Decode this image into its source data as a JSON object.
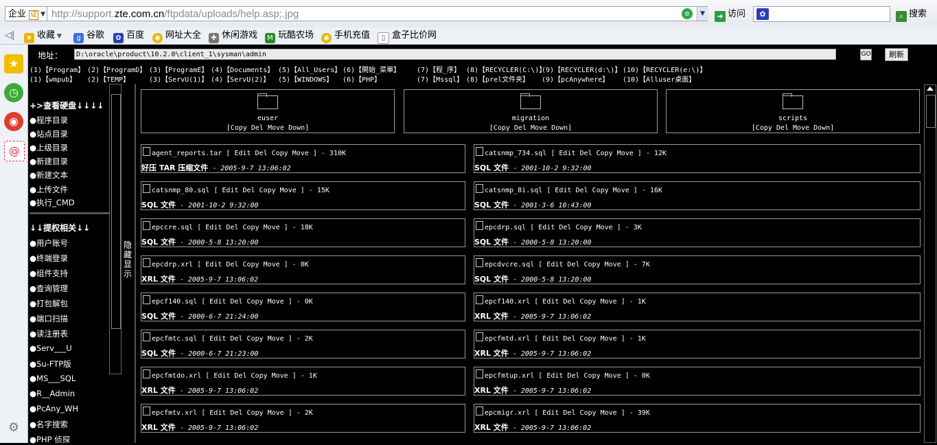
{
  "browser": {
    "combo_label": "企业",
    "combo_badge": "证",
    "url_prefix": "http://support.",
    "url_host": "zte.com.cn",
    "url_rest": "/ftpdata/uploads/help.asp;.jpg",
    "visit_label": "访问",
    "search_label": "搜索"
  },
  "favorites": [
    "收藏",
    "谷歌",
    "百度",
    "网址大全",
    "休闲游戏",
    "玩酷农场",
    "手机充值",
    "盒子比价网"
  ],
  "page": {
    "addr_label": "地址：",
    "path": "D:\\oracle\\product\\10.2.0\\client_1\\sysman\\admin",
    "go_label": "GO",
    "refresh_label": "刷新",
    "quick_row1": [
      "(1)【Program】",
      "(2)【ProgramD】",
      "(3)【ProgramE】",
      "(4)【Documents】",
      "(5)【All_Users】",
      "(6)【開始_菜單】",
      "(7)【程_序】",
      "(8)【RECYCLER(C:\\)】",
      "(9)【RECYCLER(d:\\)】",
      "(10)【RECYCLER(e:\\)】"
    ],
    "quick_row2": [
      "(1)【wmpub】",
      "(2)【TEMP】",
      "(3)【ServU(1)】",
      "(4)【ServU(2)】",
      "(5)【WINDOWS】",
      "(6)【PHP】",
      "(7)【Mssql】",
      "(8)【prel文件夹】",
      "(9)【pcAnywhere】",
      "(10)【Alluser桌面】"
    ],
    "menu_head1": "+>查看硬盘↓↓↓↓",
    "menu_group1": [
      "●程序目录",
      "●站点目录",
      "●上级目录",
      "●新建目录",
      "●新建文本",
      "●上传文件",
      "●执行_CMD"
    ],
    "menu_head2": "↓↓提权相关↓↓",
    "menu_group2": [
      "●用户账号",
      "●终端登录",
      "●组件支持",
      "●查询管理",
      "●打包解包",
      "●端口扫描",
      "●读注册表",
      "●Serv___U",
      "●Su-FTP版",
      "●MS___SQL",
      "●R__Admin",
      "●PcAny_WH",
      "●名字搜索",
      "●PHP 侦探"
    ],
    "hide_show": "隐藏 显示",
    "folder_actions": "[Copy Del Move Down]",
    "folders": [
      "euser",
      "migration",
      "scripts"
    ],
    "files": [
      {
        "name": "agent_reports.tar",
        "size": "310K",
        "type": "好压 TAR 压缩文件",
        "date": "2005-9-7 13:06:02"
      },
      {
        "name": "catsnmp_734.sql",
        "size": "12K",
        "type": "SQL 文件",
        "date": "2001-10-2 9:32:00"
      },
      {
        "name": "catsnmp_80.sql",
        "size": "15K",
        "type": "SQL 文件",
        "date": "2001-10-2 9:32:00"
      },
      {
        "name": "catsnmp_8i.sql",
        "size": "16K",
        "type": "SQL 文件",
        "date": "2001-3-6 10:43:00"
      },
      {
        "name": "epccre.sql",
        "size": "18K",
        "type": "SQL 文件",
        "date": "2000-5-8 13:20:00"
      },
      {
        "name": "epcdrp.sql",
        "size": "3K",
        "type": "SQL 文件",
        "date": "2000-5-8 13:20:00"
      },
      {
        "name": "epcdrp.xrl",
        "size": "0K",
        "type": "XRL 文件",
        "date": "2005-9-7 13:06:02"
      },
      {
        "name": "epcdvcre.sql",
        "size": "7K",
        "type": "SQL 文件",
        "date": "2000-5-8 13:20:00"
      },
      {
        "name": "epcf140.sql",
        "size": "0K",
        "type": "SQL 文件",
        "date": "2000-6-7 21:24:00"
      },
      {
        "name": "epcf140.xrl",
        "size": "1K",
        "type": "XRL 文件",
        "date": "2005-9-7 13:06:02"
      },
      {
        "name": "epcfmtc.sql",
        "size": "2K",
        "type": "SQL 文件",
        "date": "2000-6-7 21:23:00"
      },
      {
        "name": "epcfmtd.xrl",
        "size": "1K",
        "type": "XRL 文件",
        "date": "2005-9-7 13:06:02"
      },
      {
        "name": "epcfmtdo.xrl",
        "size": "1K",
        "type": "XRL 文件",
        "date": "2005-9-7 13:06:02"
      },
      {
        "name": "epcfmtup.xrl",
        "size": "0K",
        "type": "XRL 文件",
        "date": "2005-9-7 13:06:02"
      },
      {
        "name": "epcfmtv.xrl",
        "size": "2K",
        "type": "XRL 文件",
        "date": "2005-9-7 13:06:02"
      },
      {
        "name": "epcmigr.xrl",
        "size": "39K",
        "type": "XRL 文件",
        "date": "2005-9-7 13:06:02"
      }
    ],
    "file_actions": "[ Edit Del Copy Move ]"
  }
}
